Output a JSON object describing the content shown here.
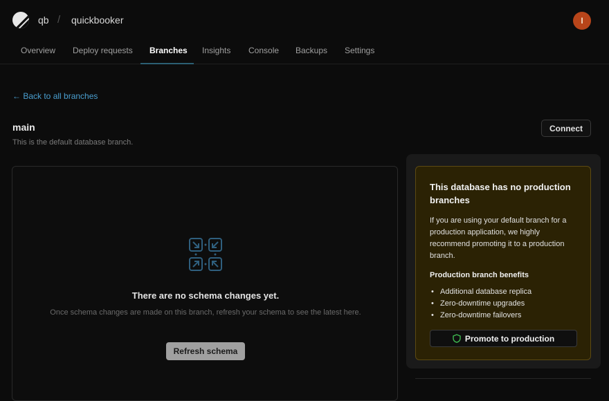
{
  "header": {
    "org": "qb",
    "separator": "/",
    "database": "quickbooker",
    "avatar_initial": "I",
    "logo_icon": "planetscale-logo-icon"
  },
  "tabs": [
    {
      "label": "Overview",
      "active": false
    },
    {
      "label": "Deploy requests",
      "active": false
    },
    {
      "label": "Branches",
      "active": true
    },
    {
      "label": "Insights",
      "active": false
    },
    {
      "label": "Console",
      "active": false
    },
    {
      "label": "Backups",
      "active": false
    },
    {
      "label": "Settings",
      "active": false
    }
  ],
  "back_link": "← Back to all branches",
  "branch": {
    "name": "main",
    "description": "This is the default database branch.",
    "connect_label": "Connect"
  },
  "schema": {
    "icon": "schema-diagram-icon",
    "empty_title": "There are no schema changes yet.",
    "empty_description": "Once schema changes are made on this branch, refresh your schema to see the latest here.",
    "refresh_label": "Refresh schema"
  },
  "production_notice": {
    "title": "This database has no production branches",
    "body": "If you are using your default branch for a production application, we highly recommend promoting it to a production branch.",
    "benefits_title": "Production branch benefits",
    "benefits": [
      "Additional database replica",
      "Zero-downtime upgrades",
      "Zero-downtime failovers"
    ],
    "promote_label": "Promote to production",
    "promote_icon": "shield-icon"
  },
  "colors": {
    "accent_link": "#4a9fd0",
    "warning_bg": "#2b2204",
    "warning_border": "#5d4a12",
    "shield": "#3fb950",
    "avatar_bg": "#b8451a"
  }
}
